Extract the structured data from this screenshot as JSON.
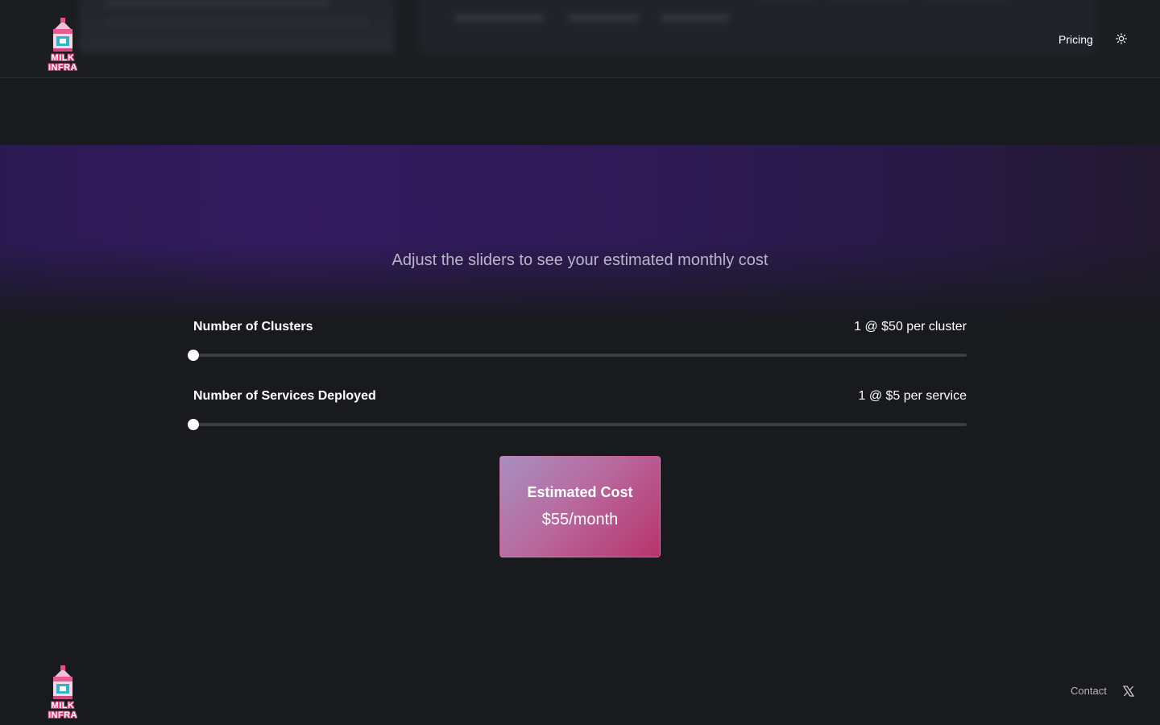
{
  "header": {
    "brand": "MILK INFRA",
    "nav_pricing": "Pricing",
    "theme_icon": "sun-icon"
  },
  "hero": {
    "subtitle": "Adjust the sliders to see your estimated monthly cost"
  },
  "sliders": [
    {
      "label": "Number of Clusters",
      "value_text": "1 @ $50 per cluster",
      "value": 1,
      "position_fraction": 0
    },
    {
      "label": "Number of Services Deployed",
      "value_text": "1 @ $5 per service",
      "value": 1,
      "position_fraction": 0
    }
  ],
  "estimate": {
    "title": "Estimated Cost",
    "value": "$55/month"
  },
  "footer": {
    "brand": "MILK INFRA",
    "contact": "Contact",
    "social_icon": "x-icon"
  },
  "colors": {
    "background": "#181a1d",
    "accent_start": "#a88fc0",
    "accent_end": "#b8336c",
    "hero_purple": "#331b5f"
  }
}
